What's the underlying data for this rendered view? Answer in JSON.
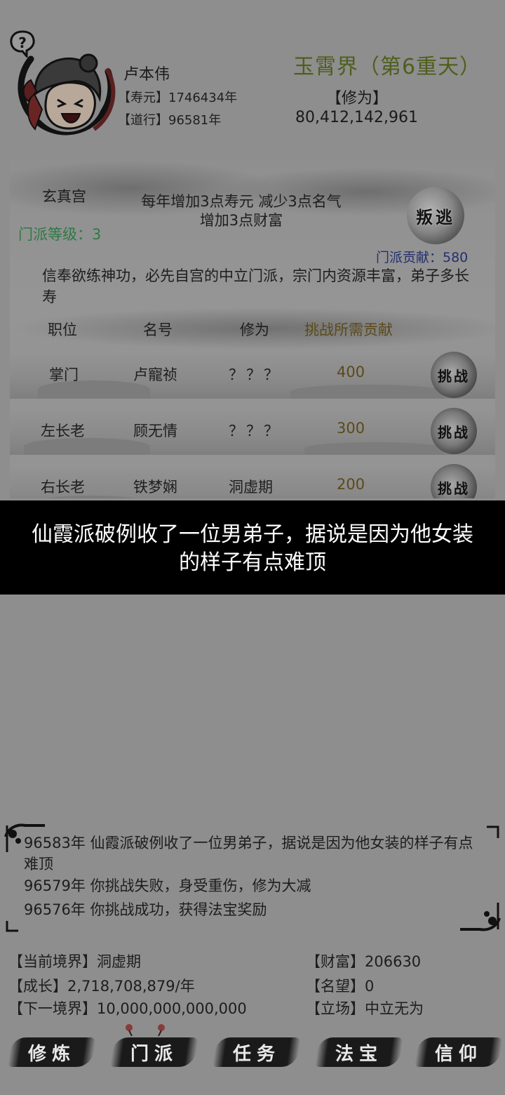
{
  "player": {
    "name": "卢本伟",
    "lifespan_label": "【寿元】1746434年",
    "dao_label": "【道行】96581年",
    "realm_title": "玉霄界（第6重天）",
    "cultivation_label": "【修为】",
    "cultivation_value": "80,412,142,961"
  },
  "sect": {
    "name": "玄真宫",
    "level_label": "门派等级：3",
    "effect_line1": "每年增加3点寿元 减少3点名气",
    "effect_line2": "增加3点财富",
    "betray_label": "叛逃",
    "contribution_label": "门派贡献：580",
    "description": "信奉欲练神功，必先自宫的中立门派，宗门内资源丰富，弟子多长寿",
    "table_headers": [
      "职位",
      "名号",
      "修为",
      "挑战所需贡献"
    ],
    "members": [
      {
        "position": "掌门",
        "name": "卢寵祯",
        "cultivation": "？？？",
        "cost": "400",
        "action": "挑战"
      },
      {
        "position": "左长老",
        "name": "顾无情",
        "cultivation": "？？？",
        "cost": "300",
        "action": "挑战"
      },
      {
        "position": "右长老",
        "name": "铁梦娴",
        "cultivation": "洞虚期",
        "cost": "200",
        "action": "挑战"
      }
    ]
  },
  "banner": {
    "text": "仙霞派破例收了一位男弟子，据说是因为他女装的样子有点难顶"
  },
  "log": {
    "entries": [
      "96583年 仙霞派破例收了一位男弟子，据说是因为他女装的样子有点难顶",
      "96579年 你挑战失败，身受重伤，修为大减",
      "96576年 你挑战成功，获得法宝奖励"
    ]
  },
  "stats": {
    "realm": "【当前境界】洞虚期",
    "growth": "【成长】2,718,708,879/年",
    "next_realm": "【下一境界】10,000,000,000,000",
    "wealth": "【财富】206630",
    "fame": "【名望】0",
    "stance": "【立场】中立无为"
  },
  "nav": {
    "items": [
      "修炼",
      "门派",
      "任务",
      "法宝",
      "信仰"
    ]
  },
  "colors": {
    "realm": "#4f5e1d",
    "sect_level": "#2e7a45",
    "contribution": "#23306e",
    "cost": "#5a4a1a",
    "challenge_header": "#5a4a1a"
  }
}
